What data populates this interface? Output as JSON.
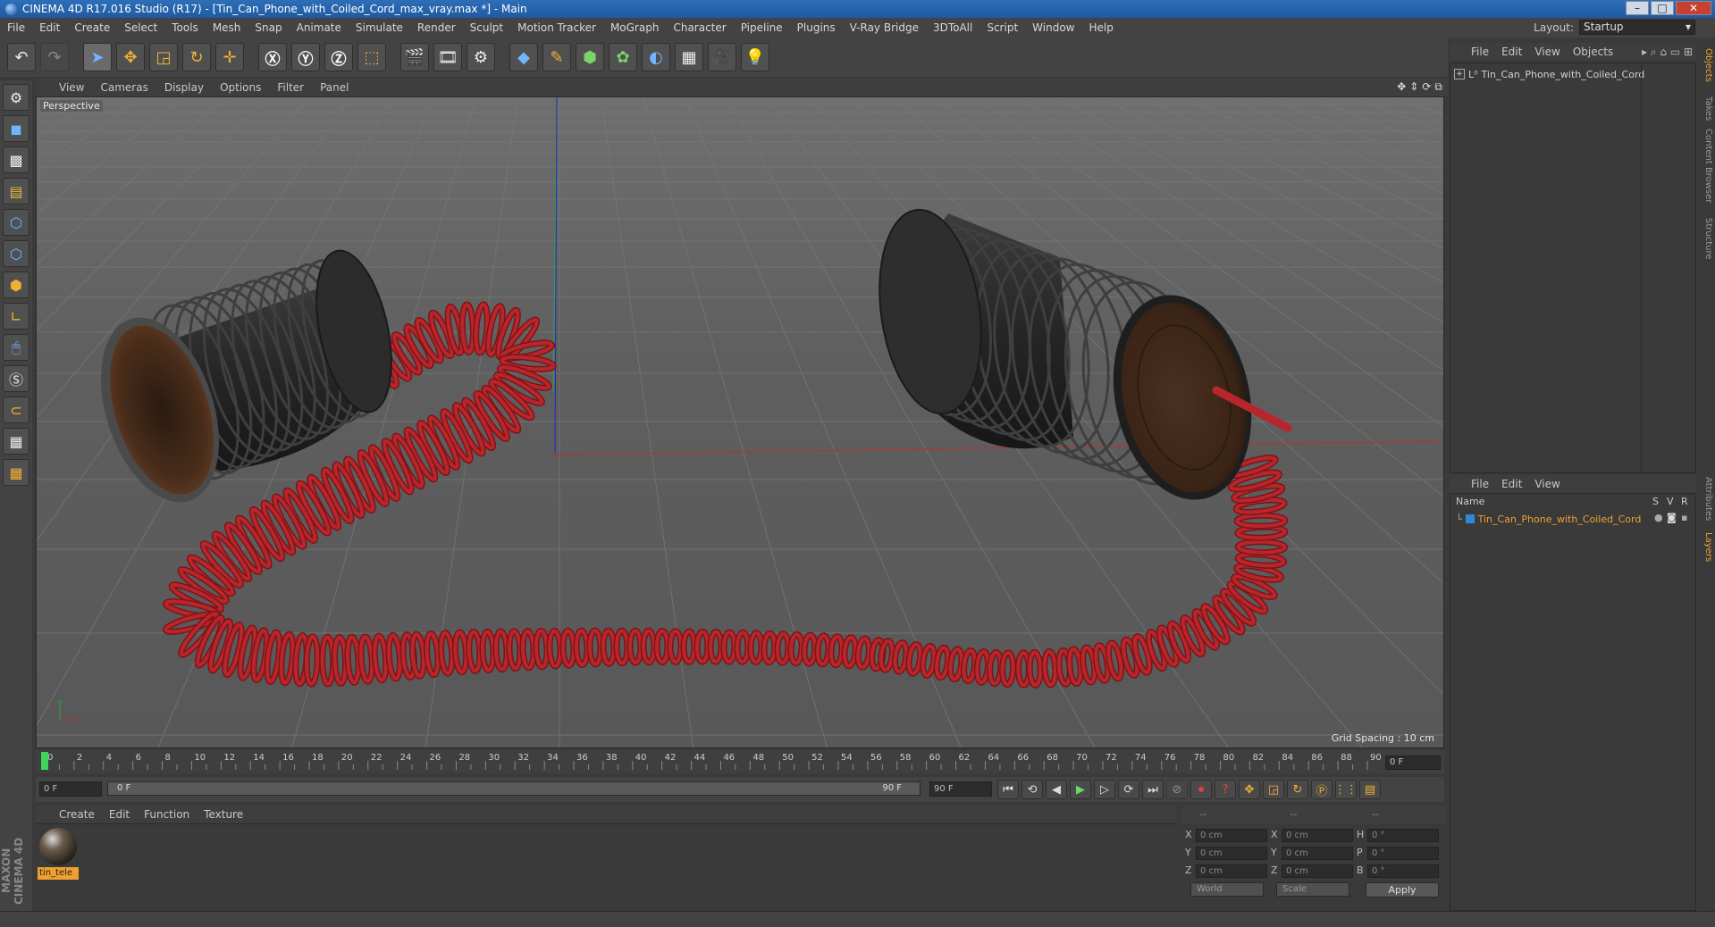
{
  "title_bar": {
    "text": "CINEMA 4D R17.016 Studio (R17) - [Tin_Can_Phone_with_Coiled_Cord_max_vray.max *] - Main"
  },
  "menu": [
    "File",
    "Edit",
    "Create",
    "Select",
    "Tools",
    "Mesh",
    "Snap",
    "Animate",
    "Simulate",
    "Render",
    "Sculpt",
    "Motion Tracker",
    "MoGraph",
    "Character",
    "Pipeline",
    "Plugins",
    "V-Ray Bridge",
    "3DToAll",
    "Script",
    "Window",
    "Help"
  ],
  "layout": {
    "label": "Layout:",
    "value": "Startup"
  },
  "viewport": {
    "menu": [
      "View",
      "Cameras",
      "Display",
      "Options",
      "Filter",
      "Panel"
    ],
    "camera_label": "Perspective",
    "grid_spacing": "Grid Spacing : 10 cm"
  },
  "timeline": {
    "ticks": [
      "0",
      "2",
      "4",
      "6",
      "8",
      "10",
      "12",
      "14",
      "16",
      "18",
      "20",
      "22",
      "24",
      "26",
      "28",
      "30",
      "32",
      "34",
      "36",
      "38",
      "40",
      "42",
      "44",
      "46",
      "48",
      "50",
      "52",
      "54",
      "56",
      "58",
      "60",
      "62",
      "64",
      "66",
      "68",
      "70",
      "72",
      "74",
      "76",
      "78",
      "80",
      "82",
      "84",
      "86",
      "88",
      "90"
    ],
    "current_frame": "0 F"
  },
  "playback": {
    "start_field": "0 F",
    "slider_start": "0 F",
    "slider_end": "90 F",
    "end_field": "90 F"
  },
  "material_manager": {
    "menu": [
      "Create",
      "Edit",
      "Function",
      "Texture"
    ],
    "material_name": "tin_tele"
  },
  "coordinates": {
    "header": [
      "--",
      "--",
      "--"
    ],
    "rows": [
      {
        "a": "X",
        "av": "0 cm",
        "b": "X",
        "bv": "0 cm",
        "c": "H",
        "cv": "0 °"
      },
      {
        "a": "Y",
        "av": "0 cm",
        "b": "Y",
        "bv": "0 cm",
        "c": "P",
        "cv": "0 °"
      },
      {
        "a": "Z",
        "av": "0 cm",
        "b": "Z",
        "bv": "0 cm",
        "c": "B",
        "cv": "0 °"
      }
    ],
    "mode1": "World",
    "mode2": "Scale",
    "apply": "Apply"
  },
  "object_manager": {
    "menu": [
      "File",
      "Edit",
      "View",
      "Objects"
    ],
    "object": "Tin_Can_Phone_with_Coiled_Cord"
  },
  "layer_manager": {
    "menu": [
      "File",
      "Edit",
      "View"
    ],
    "col_name": "Name",
    "col_s": "S",
    "col_v": "V",
    "col_r": "R",
    "layer": "Tin_Can_Phone_with_Coiled_Cord",
    "layer_color": "#2e8ad8"
  },
  "right_tabs": [
    "Objects",
    "Takes",
    "Content Browser",
    "Structure",
    "Attributes",
    "Layers"
  ],
  "brand": "MAXON CINEMA 4D",
  "colors": {
    "cord": "#b8262b",
    "can": "#2a2a2a",
    "selection": "#f0a030"
  }
}
